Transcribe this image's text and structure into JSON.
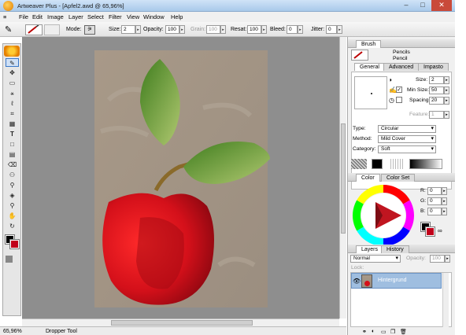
{
  "window": {
    "title": "Artweaver Plus - [Apfel2.awd @ 65,96%]",
    "controls": [
      "–",
      "□",
      "✕"
    ]
  },
  "menu": [
    "File",
    "Edit",
    "Image",
    "Layer",
    "Select",
    "Filter",
    "View",
    "Window",
    "Help"
  ],
  "options": {
    "mode_label": "Mode:",
    "size_label": "Size:",
    "size_value": "2",
    "opacity_label": "Opacity:",
    "opacity_value": "100",
    "grain_label": "Grain:",
    "grain_value": "100",
    "resat_label": "Resat:",
    "resat_value": "100",
    "bleed_label": "Bleed:",
    "bleed_value": "0",
    "jitter_label": "Jitter:",
    "jitter_value": "0"
  },
  "brush": {
    "panel_title": "Brush",
    "category": "Pencils",
    "variant": "Pencil",
    "tabs": [
      "General",
      "Advanced",
      "Impasto"
    ],
    "size_label": "Size:",
    "size_value": "2",
    "min_size_label": "Min Size:",
    "min_size_value": "50",
    "spacing_label": "Spacing:",
    "spacing_value": "20",
    "feature_label": "Feature:",
    "feature_value": "1",
    "type_label": "Type:",
    "type_value": "Circular",
    "method_label": "Method:",
    "method_value": "Mild Cover",
    "category_label": "Category:",
    "category_value": "Soft"
  },
  "color": {
    "tabs": [
      "Color",
      "Color Set"
    ],
    "r_label": "R:",
    "r_value": "0",
    "g_label": "G:",
    "g_value": "0",
    "b_label": "B:",
    "b_value": "0",
    "primary": "#000000",
    "secondary": "#c0001a"
  },
  "layers": {
    "tabs": [
      "Layers",
      "History"
    ],
    "blend_mode": "Normal",
    "opacity_label": "Opacity:",
    "opacity_value": "100",
    "lock_label": "Lock:",
    "items": [
      {
        "name": "Hintergrund"
      }
    ]
  },
  "status": {
    "zoom": "65,96%",
    "tool": "Dropper Tool"
  },
  "accent": "#3a78c8"
}
